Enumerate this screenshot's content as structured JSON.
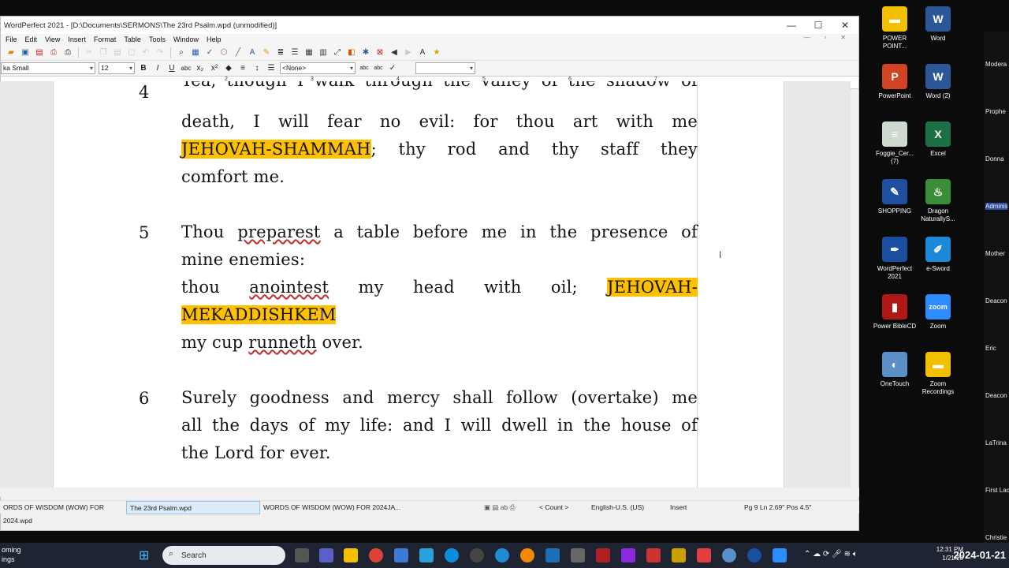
{
  "window": {
    "title": "WordPerfect 2021 - [D:\\Documents\\SERMONS\\The 23rd Psalm.wpd (unmodified)]",
    "controls": [
      "—",
      "☐",
      "✕"
    ]
  },
  "menu": [
    "File",
    "Edit",
    "View",
    "Insert",
    "Format",
    "Table",
    "Tools",
    "Window",
    "Help"
  ],
  "propbar": {
    "font": "ka Small",
    "size": "12",
    "style": "<None>"
  },
  "ruler": [
    "2",
    "3",
    "4",
    "5",
    "6",
    "7"
  ],
  "document": {
    "v4_num": "4",
    "v4_line0": "Yea, though I walk through the valley of the shadow of",
    "v4_line1": "death, I will fear no evil: for thou art with me",
    "v4_hl": "JEHOVAH-SHAMMAH",
    "v4_line2_rest": "; thy rod and thy staff they",
    "v4_line3": "comfort me.",
    "v5_num": "5",
    "v5_line1_a": "Thou ",
    "v5_line1_b": "preparest",
    "v5_line1_c": " a table before me in the presence of",
    "v5_line2": "mine enemies:",
    "v5_line3_a": "thou ",
    "v5_line3_b": "anointest",
    "v5_line3_c": " my head with oil; ",
    "v5_hl1": "JEHOVAH-",
    "v5_hl2": "MEKADDISHKEM",
    "v5_line5_a": "my cup ",
    "v5_line5_b": "runneth",
    "v5_line5_c": " over.",
    "v6_num": "6",
    "v6_line1": "Surely goodness and mercy shall follow (overtake) me",
    "v6_line2": "all the days of my life: and I will dwell in the house of",
    "v6_line3": "the Lord for ever."
  },
  "status": {
    "tab1": "ORDS OF WISDOM (WOW) FOR 2024.wpd",
    "tab2": "The 23rd Psalm.wpd",
    "tab3": "WORDS OF WISDOM (WOW) FOR 2024JA...",
    "count": "< Count >",
    "lang": "English-U.S. (US)",
    "mode": "Insert",
    "position": "Pg 9 Ln 2.69\" Pos 4.5\""
  },
  "desktop_icons": [
    {
      "label": "POWER POINT...",
      "color": "#f3c000",
      "glyph": "▬"
    },
    {
      "label": "Word",
      "color": "#2b5797",
      "glyph": "W"
    },
    {
      "label": "PowerPoint",
      "color": "#d04423",
      "glyph": "P"
    },
    {
      "label": "Word (2)",
      "color": "#2b5797",
      "glyph": "W"
    },
    {
      "label": "Foggie_Cer... (7)",
      "color": "#cfd8cf",
      "glyph": "≡"
    },
    {
      "label": "Excel",
      "color": "#1d7044",
      "glyph": "X"
    },
    {
      "label": "SHOPPING",
      "color": "#1e4fa0",
      "glyph": "✎"
    },
    {
      "label": "Dragon NaturallyS...",
      "color": "#3a8e3a",
      "glyph": "♨"
    },
    {
      "label": "WordPerfect 2021",
      "color": "#1a4fa0",
      "glyph": "✒"
    },
    {
      "label": "e-Sword",
      "color": "#1e88d8",
      "glyph": "✐"
    },
    {
      "label": "Power BibleCD",
      "color": "#b01818",
      "glyph": "▮"
    },
    {
      "label": "Zoom",
      "color": "#2d8cff",
      "glyph": "zoom"
    },
    {
      "label": "OneTouch",
      "color": "#5a8fc8",
      "glyph": "◐"
    },
    {
      "label": "Zoom Recordings",
      "color": "#f3c000",
      "glyph": "▬"
    }
  ],
  "participants": [
    "Modera",
    "Prophe",
    "Donna",
    "Adminis",
    "Mother",
    "Deacon",
    "Eric",
    "Deacon",
    "LaTrina",
    "First Lac",
    "Christie"
  ],
  "taskbar": {
    "weather_line1": "oming",
    "weather_line2": "ings",
    "search": "Search",
    "time": "12:31 PM",
    "date": "1/21/20",
    "stamp": "2024-01-21"
  }
}
